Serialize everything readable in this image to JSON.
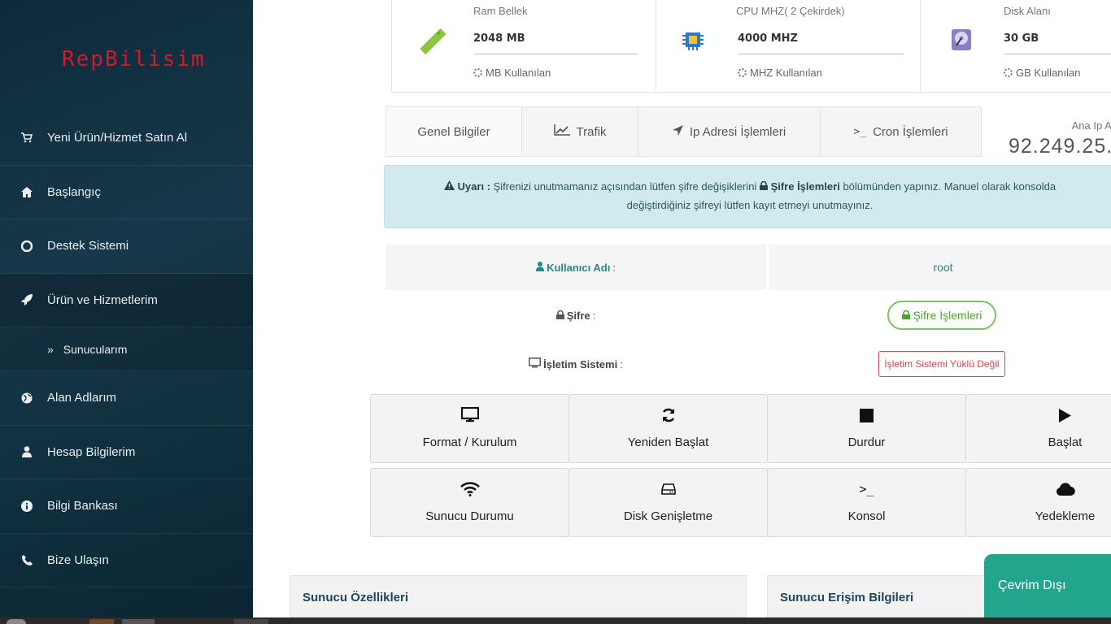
{
  "brand": {
    "logo_text": "RepBilisim"
  },
  "sidebar": {
    "items": [
      {
        "label": "Yeni Ürün/Hizmet Satın Al",
        "icon": "cart-icon"
      },
      {
        "label": "Başlangıç",
        "icon": "home-icon"
      },
      {
        "label": "Destek Sistemi",
        "icon": "lifebuoy-icon"
      },
      {
        "label": "Ürün ve Hizmetlerim",
        "icon": "rocket-icon",
        "active": true
      },
      {
        "label": "Sunucularım",
        "icon": "double-chevron-right-icon",
        "sub": true
      },
      {
        "label": "Alan Adlarım",
        "icon": "globe-icon"
      },
      {
        "label": "Hesap Bilgilerim",
        "icon": "user-icon"
      },
      {
        "label": "Bilgi Bankası",
        "icon": "info-icon"
      },
      {
        "label": "Bize Ulaşın",
        "icon": "phone-icon"
      }
    ]
  },
  "stats": {
    "ram": {
      "title": "Ram Bellek",
      "value": "2048 MB",
      "used": "MB Kullanılan",
      "icon": "ram-icon"
    },
    "cpu": {
      "title": "CPU MHZ( 2 Çekirdek)",
      "value": "4000 MHZ",
      "used": "MHZ Kullanılan",
      "icon": "cpu-chip-icon"
    },
    "disk": {
      "title": "Disk Alanı",
      "value": "30 GB",
      "used": "GB Kullanılan",
      "icon": "hard-disk-icon"
    }
  },
  "tabs": [
    {
      "label": "Genel Bilgiler"
    },
    {
      "label": "Trafik",
      "icon": "line-chart-icon"
    },
    {
      "label": "Ip Adresi İşlemleri",
      "icon": "location-arrow-icon"
    },
    {
      "label": "Cron İşlemleri",
      "icon": "terminal-icon"
    }
  ],
  "ip": {
    "label": "Ana Ip Ad",
    "value": "92.249.25."
  },
  "alert": {
    "warning_label": "Uyarı :",
    "text_1": " Şifrenizi unutmamanız açısından lütfen şifre değişiklerini ",
    "link": "Şifre İşlemleri",
    "text_2": " bölümünden yapınız. Manuel olarak konsolda",
    "line_2": "değiştirdiğiniz şifreyi lütfen kayıt etmeyi unutmayınız."
  },
  "info": {
    "username_label": "Kullanıcı Adı",
    "username_value": "root",
    "password_label": "Şifre",
    "password_button": "Şifre İşlemleri",
    "os_label": "İşletim Sistemi",
    "os_value": "İşletim Sistemi Yüklü Değil",
    "colon": ":"
  },
  "actions": [
    {
      "label": "Format / Kurulum",
      "icon": "monitor-icon"
    },
    {
      "label": "Yeniden Başlat",
      "icon": "refresh-icon"
    },
    {
      "label": "Durdur",
      "icon": "stop-icon"
    },
    {
      "label": "Başlat",
      "icon": "play-icon"
    },
    {
      "label": "Sunucu Durumu",
      "icon": "wifi-icon"
    },
    {
      "label": "Disk Genişletme",
      "icon": "hdd-icon"
    },
    {
      "label": "Konsol",
      "icon": "terminal-icon"
    },
    {
      "label": "Yedekleme",
      "icon": "cloud-icon"
    }
  ],
  "panels": {
    "left_title": "Sunucu Özellikleri",
    "right_title": "Sunucu Erişim Bilgileri"
  },
  "chat": {
    "label": "Çevrim Dışı"
  },
  "colors": {
    "accent": "#21a58c",
    "sidebar": "#17384a",
    "logo": "#d11a2a",
    "teal": "#1f8b86",
    "danger": "#e0454b",
    "success": "#4aa62f"
  }
}
